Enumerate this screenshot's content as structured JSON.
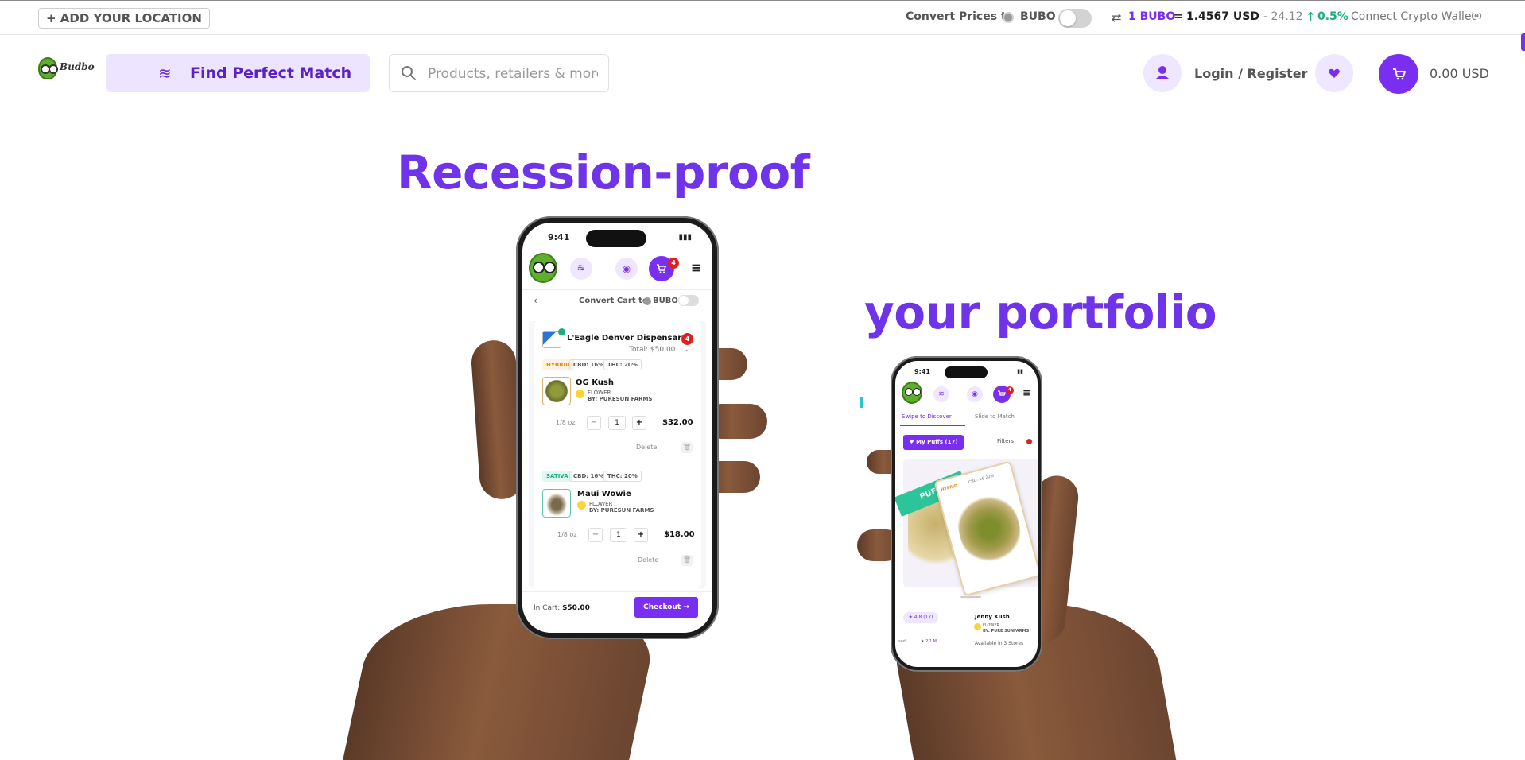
{
  "topbar": {
    "location_button": "+ ADD YOUR LOCATION",
    "convert_label": "Convert Prices to",
    "token": "BUBO",
    "rate_icon": "⇄",
    "rate_one": "1 BUBO",
    "rate_eq": "=",
    "rate_usd": "1.4567 USD",
    "rate_change": "- 24.12",
    "rate_arrow": "↑",
    "rate_pct": "0.5%",
    "wallet_label": "Connect Crypto Wallet",
    "wallet_icon": "wifi-icon"
  },
  "header": {
    "logo_text": "Budbo",
    "match_label": "Find Perfect Match",
    "match_icon": "≋",
    "search_placeholder": "Products, retailers & more",
    "login_label": "Login / Register",
    "cart_total": "0.00 USD"
  },
  "hero": {
    "line1": "Recession-proof",
    "line2": "your portfolio"
  },
  "phone_cart": {
    "time": "9:41",
    "battery": "▮▮▮",
    "nav_icon_1": "≋",
    "nav_icon_2": "◉",
    "cart_icon": "🛒",
    "cart_badge": "4",
    "menu_icon": "≡",
    "back": "‹",
    "convert_label": "Convert Cart to",
    "token": "BUBO",
    "store_name": "L'Eagle Denver Dispensary",
    "store_badge": "4",
    "store_total": "Total: $50.00",
    "chevron": "⌄",
    "items": [
      {
        "strain": "HYBRID",
        "cbd": "CBD: 16%",
        "thc": "THC: 20%",
        "name": "OG Kush",
        "type": "FLOWER",
        "brand": "BY: PURESUN FARMS",
        "weight": "1/8 oz",
        "minus": "−",
        "qty": "1",
        "plus": "+",
        "price": "$32.00",
        "delete": "Delete",
        "trash": "🗑"
      },
      {
        "strain": "SATIVA",
        "cbd": "CBD: 16%",
        "thc": "THC: 20%",
        "name": "Maui Wowie",
        "type": "FLOWER",
        "brand": "BY: PURESUN FARMS",
        "weight": "1/8 oz",
        "minus": "−",
        "qty": "1",
        "plus": "+",
        "price": "$18.00",
        "delete": "Delete",
        "trash": "🗑"
      }
    ],
    "in_cart_label": "In Cart:",
    "in_cart_total": "$50.00",
    "checkout_label": "Checkout →"
  },
  "phone_swipe": {
    "time": "9:41",
    "battery": "▮▮",
    "nav_icon_1": "≋",
    "nav_icon_2": "◉",
    "cart_icon": "🛒",
    "cart_badge": "4",
    "menu_icon": "≡",
    "tab1": "Swipe to Discover",
    "tab2": "Slide to Match",
    "puffs_label": "♥ My Puffs (17)",
    "filters_label": "Filters",
    "puff_strip": "PUFF",
    "card_strain": "HYBRID",
    "card_cbd": "CBD: 16.20%",
    "rating": "★ 4.8 (17)",
    "product_name": "Jenny Kush",
    "product_type": "FLOWER",
    "product_brand": "BY: PURE SUNFARMS",
    "availability": "Available in 3 Stores",
    "side_label": "sed",
    "distance": "★ 2.1 Mi"
  }
}
